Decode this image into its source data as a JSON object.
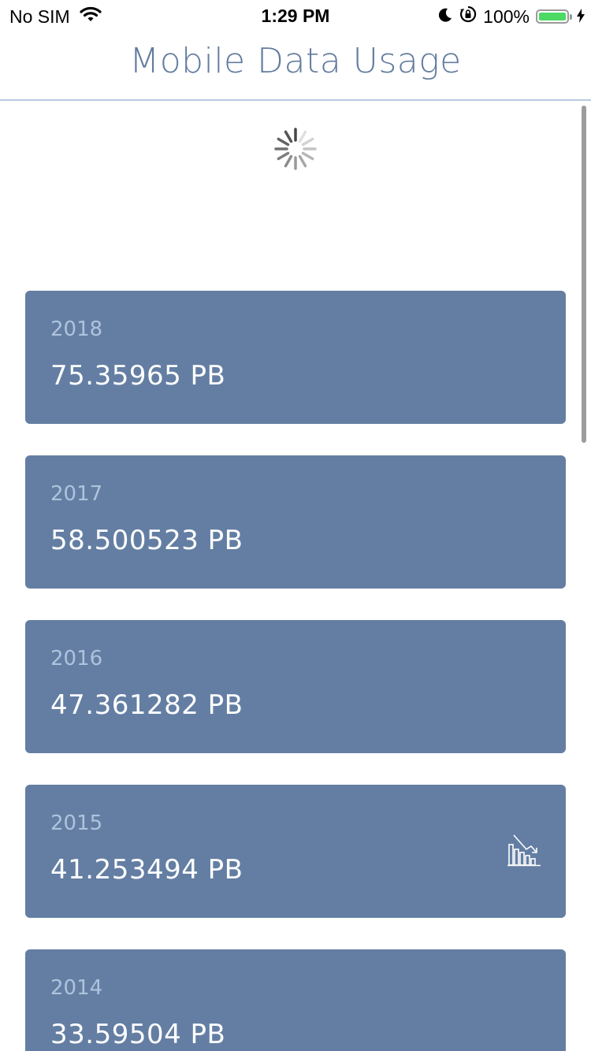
{
  "status_bar": {
    "carrier": "No SIM",
    "time": "1:29 PM",
    "battery": "100%"
  },
  "nav": {
    "title": "Mobile Data Usage"
  },
  "records": [
    {
      "year": "2018",
      "value": "75.35965 PB"
    },
    {
      "year": "2017",
      "value": "58.500523 PB"
    },
    {
      "year": "2016",
      "value": "47.361282 PB"
    },
    {
      "year": "2015",
      "value": "41.253494 PB",
      "icon": "decrease-chart-icon"
    },
    {
      "year": "2014",
      "value": "33.59504 PB"
    }
  ],
  "colors": {
    "card": "#647ea3",
    "title": "#637c9f",
    "year": "#aec3dd",
    "battery": "#4cd964"
  }
}
